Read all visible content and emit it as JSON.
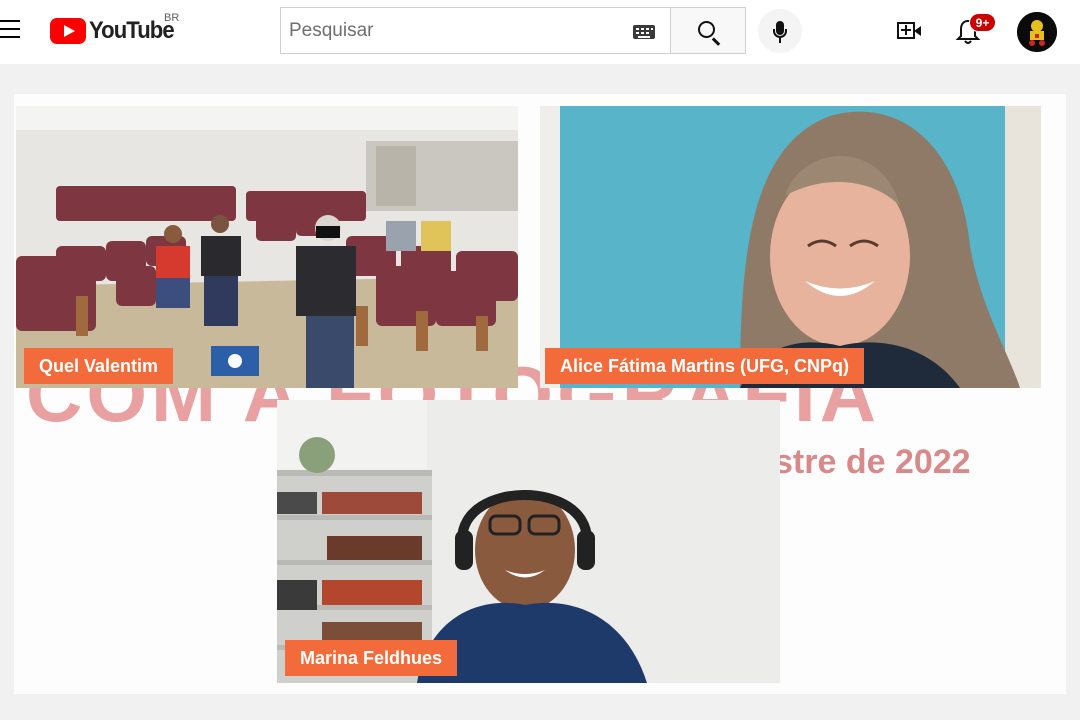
{
  "header": {
    "logo_text": "YouTube",
    "region": "BR",
    "search": {
      "placeholder": "Pesquisar",
      "value": ""
    },
    "notifications_count": "9+",
    "icons": [
      "menu-icon",
      "keyboard-icon",
      "search-icon",
      "mic-icon",
      "create-video-icon",
      "bell-icon",
      "avatar"
    ]
  },
  "video": {
    "background_title": "COM A FOTOGRAFIA",
    "background_subtitle": "stre de 2022",
    "participants": [
      {
        "name": "Quel Valentim"
      },
      {
        "name": "Alice Fátima Martins (UFG, CNPq)"
      },
      {
        "name": "Marina Feldhues"
      }
    ],
    "name_tag_color": "#f36b3a"
  },
  "colors": {
    "brand": "#ff0000",
    "badge": "#cc0000",
    "accent": "#f36b3a"
  }
}
